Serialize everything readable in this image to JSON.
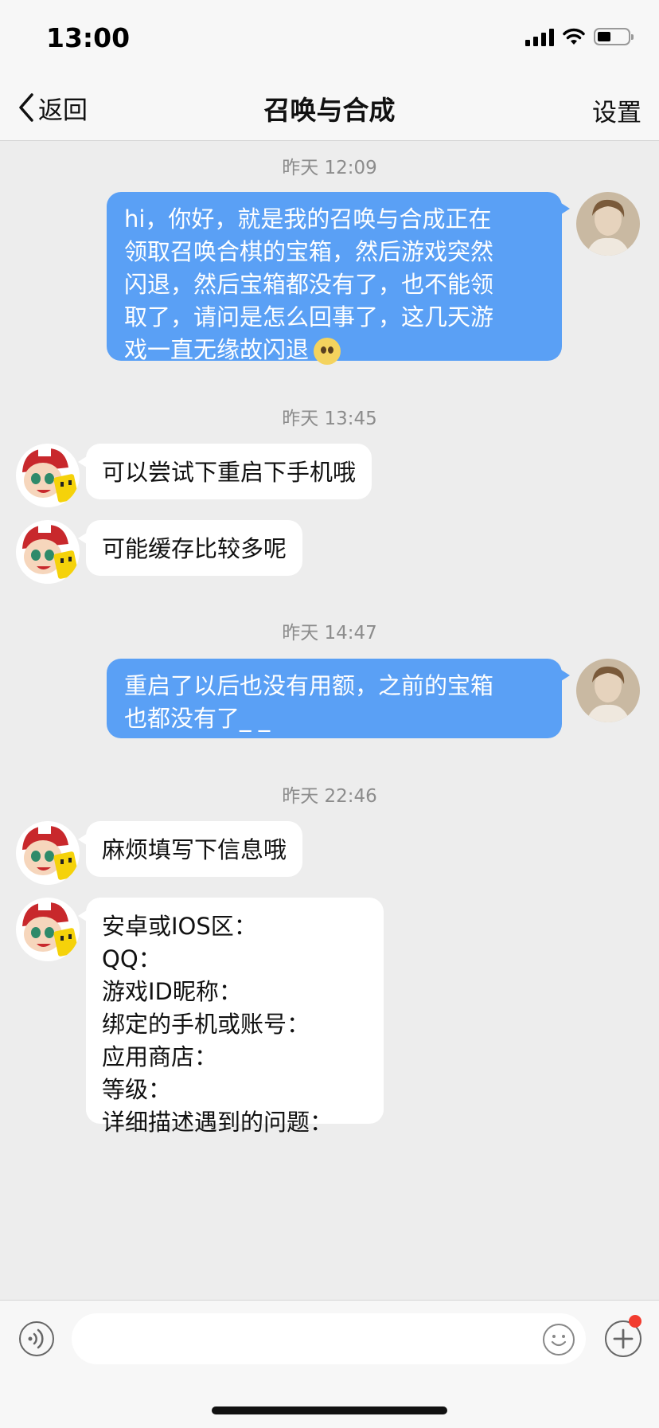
{
  "status_bar": {
    "time": "13:00"
  },
  "nav": {
    "back_label": "返回",
    "title": "召唤与合成",
    "settings_label": "设置"
  },
  "messages": [
    {
      "type": "timestamp",
      "text": "昨天 12:09"
    },
    {
      "type": "outgoing",
      "text": "hi，你好，就是我的召唤与合成正在\n领取召唤合棋的宝箱，然后游戏突然\n闪退，然后宝箱都没有了，也不能领\n取了，请问是怎么回事了，这几天游\n戏一直无缘故闪退",
      "emoji": "pleading-face"
    },
    {
      "type": "timestamp",
      "text": "昨天 13:45"
    },
    {
      "type": "incoming",
      "text": "可以尝试下重启下手机哦"
    },
    {
      "type": "incoming",
      "text": "可能缓存比较多呢"
    },
    {
      "type": "timestamp",
      "text": "昨天 14:47"
    },
    {
      "type": "outgoing",
      "text": "重启了以后也没有用额，之前的宝箱\n也都没有了_ _"
    },
    {
      "type": "timestamp",
      "text": "昨天 22:46"
    },
    {
      "type": "incoming",
      "text": "麻烦填写下信息哦"
    },
    {
      "type": "incoming",
      "text": "安卓或IOS区：\nQQ：\n游戏ID昵称：\n绑定的手机或账号：\n应用商店：\n等级：\n详细描述遇到的问题："
    }
  ],
  "input_bar": {
    "text_value": "",
    "placeholder": ""
  },
  "colors": {
    "outgoing_bubble": "#5aa0f5",
    "incoming_bubble": "#ffffff",
    "background": "#ededed",
    "notification_dot": "#f23c2f"
  },
  "icons": [
    "back-chevron-icon",
    "signal-icon",
    "wifi-icon",
    "battery-icon",
    "voice-icon",
    "emoji-icon",
    "plus-icon"
  ]
}
